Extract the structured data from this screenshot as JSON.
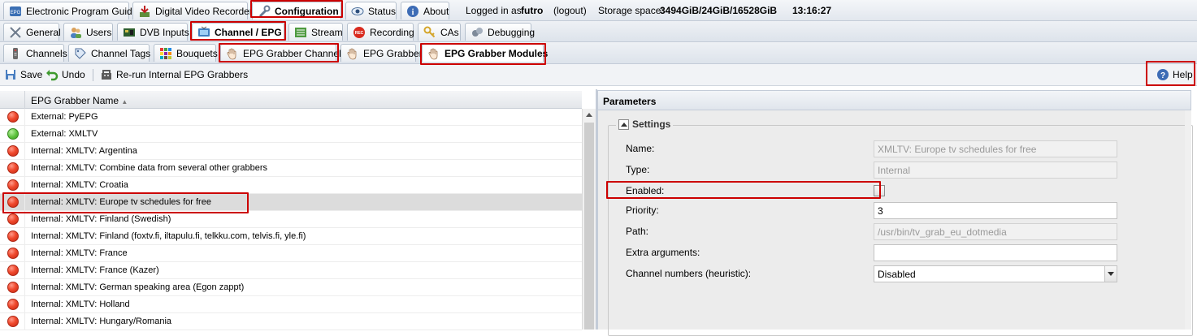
{
  "top_tabs": [
    {
      "label": "Electronic Program Guide",
      "icon": "epg-icon"
    },
    {
      "label": "Digital Video Recorder",
      "icon": "dvr-download-icon"
    },
    {
      "label": "Configuration",
      "icon": "wrench-icon"
    },
    {
      "label": "Status",
      "icon": "eye-icon"
    },
    {
      "label": "About",
      "icon": "info-icon"
    }
  ],
  "session": {
    "logged_in_prefix": "Logged in as",
    "username": "futro",
    "logout": "(logout)",
    "storage_label": "Storage space:",
    "storage_value": "3494GiB/24GiB/16528GiB",
    "time": "13:16:27"
  },
  "config_tabs": [
    {
      "label": "General",
      "icon": "tools-icon"
    },
    {
      "label": "Users",
      "icon": "users-icon"
    },
    {
      "label": "DVB Inputs",
      "icon": "dvb-card-icon"
    },
    {
      "label": "Channel / EPG",
      "icon": "tv-icon"
    },
    {
      "label": "Stream",
      "icon": "stream-icon"
    },
    {
      "label": "Recording",
      "icon": "rec-icon"
    },
    {
      "label": "CAs",
      "icon": "key-icon"
    },
    {
      "label": "Debugging",
      "icon": "bug-icon"
    }
  ],
  "epg_tabs": [
    {
      "label": "Channels",
      "icon": "remote-icon"
    },
    {
      "label": "Channel Tags",
      "icon": "tag-icon"
    },
    {
      "label": "Bouquets",
      "icon": "bouquet-grid-icon"
    },
    {
      "label": "EPG Grabber Channels",
      "icon": "grabber-hand-icon"
    },
    {
      "label": "EPG Grabber",
      "icon": "grabber-hand-icon"
    },
    {
      "label": "EPG Grabber Modules",
      "icon": "grabber-hand-icon"
    }
  ],
  "toolbar": {
    "save": "Save",
    "undo": "Undo",
    "rerun": "Re-run Internal EPG Grabbers",
    "help": "Help"
  },
  "grid": {
    "column": "EPG Grabber Name",
    "rows": [
      {
        "name": "External: PyEPG",
        "enabled": false
      },
      {
        "name": "External: XMLTV",
        "enabled": true
      },
      {
        "name": "Internal: XMLTV: Argentina",
        "enabled": false
      },
      {
        "name": "Internal: XMLTV: Combine data from several other grabbers",
        "enabled": false
      },
      {
        "name": "Internal: XMLTV: Croatia",
        "enabled": false
      },
      {
        "name": "Internal: XMLTV: Europe tv schedules for free",
        "enabled": false,
        "selected": true
      },
      {
        "name": "Internal: XMLTV: Finland (Swedish)",
        "enabled": false
      },
      {
        "name": "Internal: XMLTV: Finland (foxtv.fi, iltapulu.fi, telkku.com, telvis.fi, yle.fi)",
        "enabled": false
      },
      {
        "name": "Internal: XMLTV: France",
        "enabled": false
      },
      {
        "name": "Internal: XMLTV: France (Kazer)",
        "enabled": false
      },
      {
        "name": "Internal: XMLTV: German speaking area (Egon zappt)",
        "enabled": false
      },
      {
        "name": "Internal: XMLTV: Holland",
        "enabled": false
      },
      {
        "name": "Internal: XMLTV: Hungary/Romania",
        "enabled": false
      }
    ]
  },
  "parameters": {
    "title": "Parameters",
    "section": "Settings",
    "fields": {
      "name_label": "Name:",
      "name_value": "XMLTV: Europe tv schedules for free",
      "type_label": "Type:",
      "type_value": "Internal",
      "enabled_label": "Enabled:",
      "enabled_checked": false,
      "priority_label": "Priority:",
      "priority_value": "3",
      "path_label": "Path:",
      "path_value": "/usr/bin/tv_grab_eu_dotmedia",
      "extra_label": "Extra arguments:",
      "extra_value": "",
      "chnum_label": "Channel numbers (heuristic):",
      "chnum_value": "Disabled"
    }
  },
  "colors": {
    "highlight": "#cc0000",
    "disabled_dot": "#e8432a",
    "enabled_dot": "#4caf32"
  }
}
